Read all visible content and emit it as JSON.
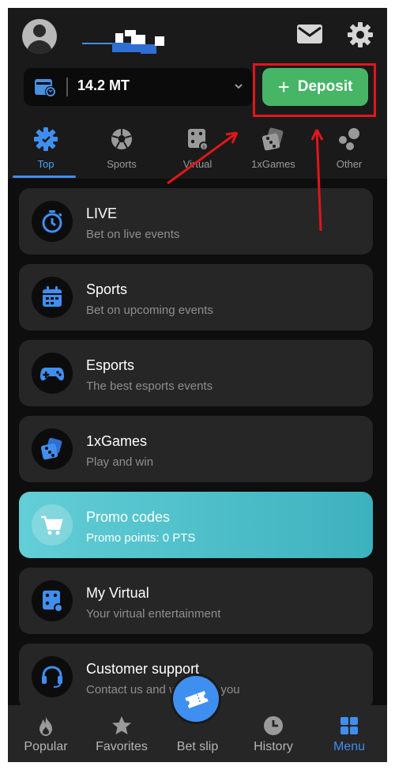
{
  "header": {
    "avatar": "avatar",
    "mail_icon": "envelope-icon",
    "settings_icon": "gear-icon"
  },
  "balance": {
    "amount": "14.2 MT",
    "icon": "wallet-icon"
  },
  "deposit": {
    "label": "Deposit",
    "plus": "+",
    "color": "#46b566"
  },
  "categories": [
    {
      "label": "Top",
      "icon": "gear-badge-icon",
      "active": true
    },
    {
      "label": "Sports",
      "icon": "football-icon"
    },
    {
      "label": "Virtual",
      "icon": "dice-screen-icon"
    },
    {
      "label": "1xGames",
      "icon": "dice-icon"
    },
    {
      "label": "Other",
      "icon": "bubbles-icon"
    }
  ],
  "menu": [
    {
      "title": "LIVE",
      "subtitle": "Bet on live events",
      "icon": "stopwatch-icon"
    },
    {
      "title": "Sports",
      "subtitle": "Bet on upcoming events",
      "icon": "calendar-icon"
    },
    {
      "title": "Esports",
      "subtitle": "The best esports events",
      "icon": "gamepad-icon"
    },
    {
      "title": "1xGames",
      "subtitle": "Play and win",
      "icon": "dice-icon"
    },
    {
      "title": "Promo codes",
      "subtitle": "Promo points: 0 PTS",
      "icon": "cart-icon"
    },
    {
      "title": "My Virtual",
      "subtitle": "Your virtual entertainment",
      "icon": "dice-screen-icon"
    },
    {
      "title": "Customer support",
      "subtitle": "Contact us and we'll help you",
      "icon": "headset-icon"
    }
  ],
  "bottom_nav": [
    {
      "label": "Popular",
      "icon": "flame-icon"
    },
    {
      "label": "Favorites",
      "icon": "star-icon"
    },
    {
      "label": "Bet slip",
      "icon": "ticket-icon"
    },
    {
      "label": "History",
      "icon": "clock-icon"
    },
    {
      "label": "Menu",
      "icon": "grid-icon",
      "active": true
    }
  ],
  "colors": {
    "accent": "#3f8ff0",
    "highlight_box": "#e0161b",
    "promo": "#4bc0ca"
  }
}
